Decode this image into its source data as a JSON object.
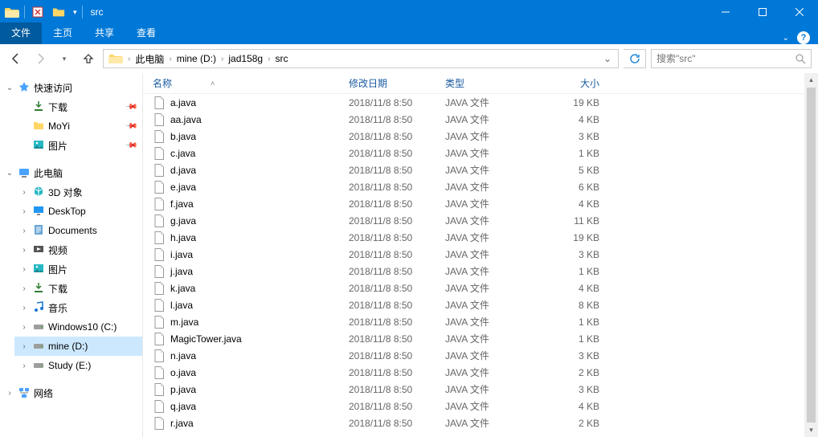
{
  "title": "src",
  "ribbon": {
    "file": "文件",
    "tabs": [
      "主页",
      "共享",
      "查看"
    ]
  },
  "breadcrumbs": [
    "此电脑",
    "mine (D:)",
    "jad158g",
    "src"
  ],
  "search_placeholder": "搜索\"src\"",
  "nav_tree": {
    "quick_access": {
      "label": "快速访问",
      "expanded": true,
      "children": [
        {
          "label": "下载",
          "icon": "download",
          "pinned": true
        },
        {
          "label": "MoYi",
          "icon": "folder",
          "pinned": true
        },
        {
          "label": "图片",
          "icon": "pictures",
          "pinned": true
        }
      ]
    },
    "this_pc": {
      "label": "此电脑",
      "expanded": true,
      "children": [
        {
          "label": "3D 对象",
          "icon": "3d"
        },
        {
          "label": "DeskTop",
          "icon": "desktop"
        },
        {
          "label": "Documents",
          "icon": "docs"
        },
        {
          "label": "视频",
          "icon": "video"
        },
        {
          "label": "图片",
          "icon": "pictures"
        },
        {
          "label": "下载",
          "icon": "download"
        },
        {
          "label": "音乐",
          "icon": "music"
        },
        {
          "label": "Windows10 (C:)",
          "icon": "drive"
        },
        {
          "label": "mine (D:)",
          "icon": "drive",
          "selected": true
        },
        {
          "label": "Study (E:)",
          "icon": "drive"
        }
      ]
    },
    "network": {
      "label": "网络",
      "expanded": false
    }
  },
  "columns": {
    "name": "名称",
    "date": "修改日期",
    "type": "类型",
    "size": "大小"
  },
  "files": [
    {
      "name": "a.java",
      "date": "2018/11/8 8:50",
      "type": "JAVA 文件",
      "size": "19 KB"
    },
    {
      "name": "aa.java",
      "date": "2018/11/8 8:50",
      "type": "JAVA 文件",
      "size": "4 KB"
    },
    {
      "name": "b.java",
      "date": "2018/11/8 8:50",
      "type": "JAVA 文件",
      "size": "3 KB"
    },
    {
      "name": "c.java",
      "date": "2018/11/8 8:50",
      "type": "JAVA 文件",
      "size": "1 KB"
    },
    {
      "name": "d.java",
      "date": "2018/11/8 8:50",
      "type": "JAVA 文件",
      "size": "5 KB"
    },
    {
      "name": "e.java",
      "date": "2018/11/8 8:50",
      "type": "JAVA 文件",
      "size": "6 KB"
    },
    {
      "name": "f.java",
      "date": "2018/11/8 8:50",
      "type": "JAVA 文件",
      "size": "4 KB"
    },
    {
      "name": "g.java",
      "date": "2018/11/8 8:50",
      "type": "JAVA 文件",
      "size": "11 KB"
    },
    {
      "name": "h.java",
      "date": "2018/11/8 8:50",
      "type": "JAVA 文件",
      "size": "19 KB"
    },
    {
      "name": "i.java",
      "date": "2018/11/8 8:50",
      "type": "JAVA 文件",
      "size": "3 KB"
    },
    {
      "name": "j.java",
      "date": "2018/11/8 8:50",
      "type": "JAVA 文件",
      "size": "1 KB"
    },
    {
      "name": "k.java",
      "date": "2018/11/8 8:50",
      "type": "JAVA 文件",
      "size": "4 KB"
    },
    {
      "name": "l.java",
      "date": "2018/11/8 8:50",
      "type": "JAVA 文件",
      "size": "8 KB"
    },
    {
      "name": "m.java",
      "date": "2018/11/8 8:50",
      "type": "JAVA 文件",
      "size": "1 KB"
    },
    {
      "name": "MagicTower.java",
      "date": "2018/11/8 8:50",
      "type": "JAVA 文件",
      "size": "1 KB"
    },
    {
      "name": "n.java",
      "date": "2018/11/8 8:50",
      "type": "JAVA 文件",
      "size": "3 KB"
    },
    {
      "name": "o.java",
      "date": "2018/11/8 8:50",
      "type": "JAVA 文件",
      "size": "2 KB"
    },
    {
      "name": "p.java",
      "date": "2018/11/8 8:50",
      "type": "JAVA 文件",
      "size": "3 KB"
    },
    {
      "name": "q.java",
      "date": "2018/11/8 8:50",
      "type": "JAVA 文件",
      "size": "4 KB"
    },
    {
      "name": "r.java",
      "date": "2018/11/8 8:50",
      "type": "JAVA 文件",
      "size": "2 KB"
    }
  ]
}
